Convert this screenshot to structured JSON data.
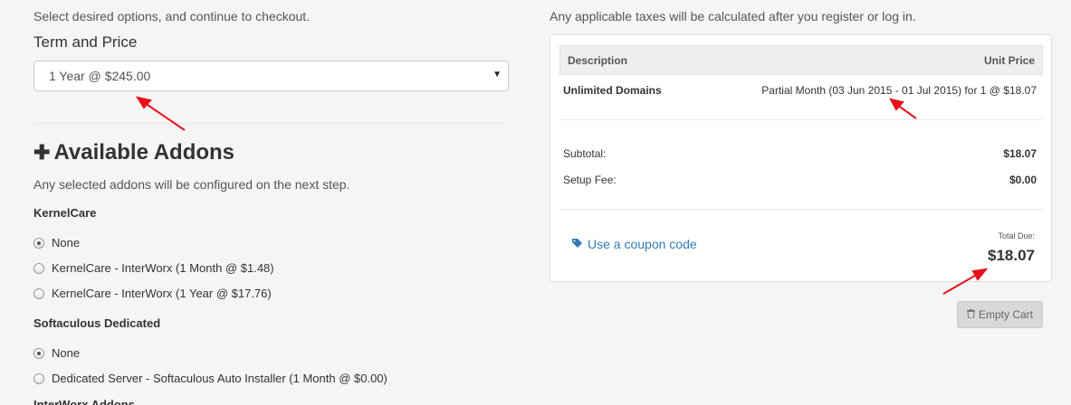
{
  "left": {
    "instructions": "Select desired options, and continue to checkout.",
    "term_label": "Term and Price",
    "term_select_value": "1 Year @ $245.00",
    "addons_heading": "Available Addons",
    "addons_description": "Any selected addons will be configured on the next step.",
    "groups": [
      {
        "title": "KernelCare",
        "options": [
          {
            "label": "None",
            "checked": true
          },
          {
            "label": "KernelCare - InterWorx (1 Month @ $1.48)",
            "checked": false
          },
          {
            "label": "KernelCare - InterWorx (1 Year @ $17.76)",
            "checked": false
          }
        ]
      },
      {
        "title": "Softaculous Dedicated",
        "options": [
          {
            "label": "None",
            "checked": true
          },
          {
            "label": "Dedicated Server - Softaculous Auto Installer (1 Month @ $0.00)",
            "checked": false
          }
        ]
      }
    ],
    "cutoff_text": "InterWorx Addons"
  },
  "right": {
    "tax_note": "Any applicable taxes will be calculated after you register or log in.",
    "summary": {
      "header_description": "Description",
      "header_unit_price": "Unit Price",
      "item_name": "Unlimited Domains",
      "item_detail": "Partial Month (03 Jun 2015 - 01 Jul 2015) for 1 @ $18.07",
      "subtotal_label": "Subtotal:",
      "subtotal_value": "$18.07",
      "setup_fee_label": "Setup Fee:",
      "setup_fee_value": "$0.00",
      "coupon_link": "Use a coupon code",
      "total_due_label": "Total Due:",
      "total_due_value": "$18.07"
    },
    "empty_cart_label": "Empty Cart"
  },
  "icons": {
    "plus": "plus-icon",
    "tag": "tag-icon",
    "trash": "trash-icon",
    "caret": "caret-down-icon"
  },
  "colors": {
    "link": "#337ab7",
    "annotation_arrow": "#e8111b",
    "page_bg": "#f5f5f5"
  }
}
